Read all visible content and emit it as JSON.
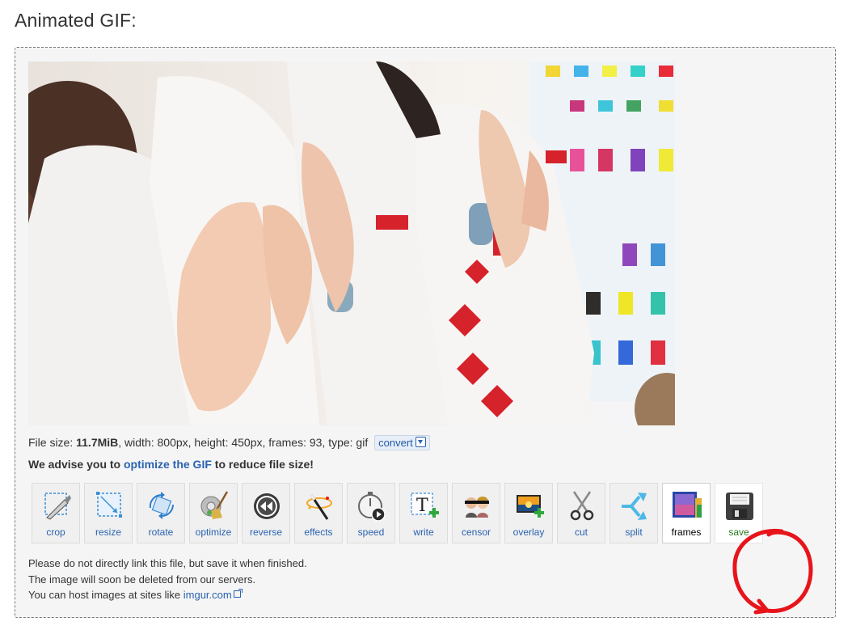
{
  "page": {
    "title": "Animated GIF:"
  },
  "file_info": {
    "prefix": "File size: ",
    "size": "11.7MiB",
    "details": ", width: 800px, height: 450px, frames: 93, type: gif",
    "convert_label": "convert"
  },
  "advice": {
    "before": "We advise you to ",
    "link": "optimize the GIF",
    "after": " to reduce file size!"
  },
  "toolbar": {
    "crop": "crop",
    "resize": "resize",
    "rotate": "rotate",
    "optimize": "optimize",
    "reverse": "reverse",
    "effects": "effects",
    "speed": "speed",
    "write": "write",
    "censor": "censor",
    "overlay": "overlay",
    "cut": "cut",
    "split": "split",
    "frames": "frames",
    "save": "save"
  },
  "notes": {
    "line1": "Please do not directly link this file, but save it when finished.",
    "line2": "The image will soon be deleted from our servers.",
    "line3_prefix": "You can host images at sites like ",
    "line3_link": "imgur.com"
  },
  "colors": {
    "link": "#2a62b0",
    "save_label": "#2b7a1d",
    "annotation": "#e8141b"
  }
}
